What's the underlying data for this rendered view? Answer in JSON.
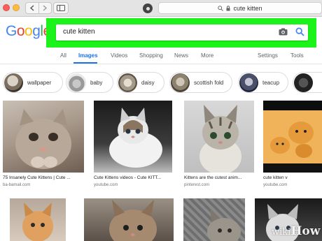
{
  "browser": {
    "address": "cute kitten"
  },
  "google": {
    "logo_letters": [
      {
        "ch": "G",
        "color": "#4285f4"
      },
      {
        "ch": "o",
        "color": "#ea4335"
      },
      {
        "ch": "o",
        "color": "#fbbc05"
      },
      {
        "ch": "g",
        "color": "#4285f4"
      },
      {
        "ch": "l",
        "color": "#34a853"
      },
      {
        "ch": "e",
        "color": "#ea4335"
      }
    ],
    "search": {
      "query": "cute kitten"
    }
  },
  "tabs": {
    "all": "All",
    "images": "Images",
    "videos": "Videos",
    "shopping": "Shopping",
    "news": "News",
    "more": "More",
    "settings": "Settings",
    "tools": "Tools"
  },
  "chips": [
    {
      "label": "wallpaper"
    },
    {
      "label": "baby"
    },
    {
      "label": "daisy"
    },
    {
      "label": "scottish fold"
    },
    {
      "label": "teacup"
    },
    {
      "label": ""
    }
  ],
  "results": [
    {
      "caption": "75 Insanely Cute Kittens | Cute ...",
      "source": "ba-bamail.com"
    },
    {
      "caption": "Cute Kittens videos - Cute KITT...",
      "source": "youtube.com"
    },
    {
      "caption": "Kittens are the cutest anim...",
      "source": "pinterest.com"
    },
    {
      "caption": "cute kitten v",
      "source": "youtube.com"
    }
  ],
  "watermark": {
    "wiki": "wiki",
    "how": "How"
  },
  "colors": {
    "highlight": "#1bf31b",
    "accent": "#1a73e8"
  }
}
